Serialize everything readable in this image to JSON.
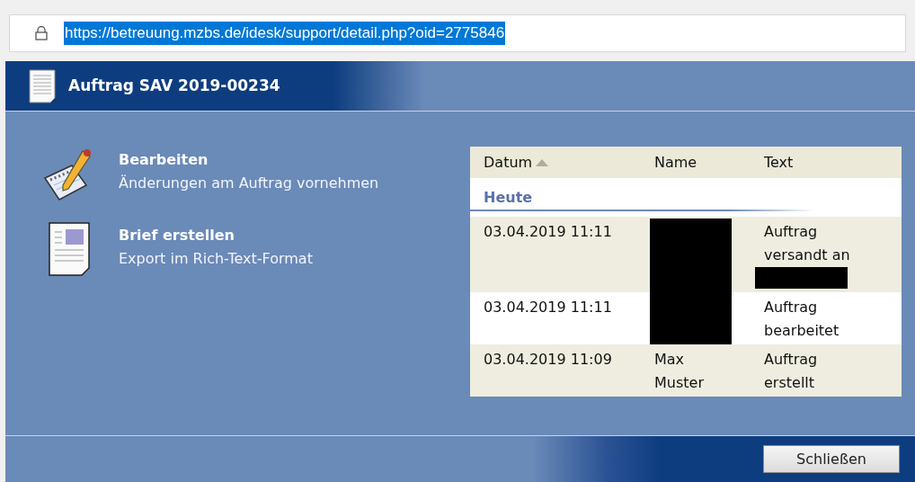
{
  "address_bar": {
    "url": "https://betreuung.mzbs.de/idesk/support/detail.php?oid=2775846",
    "url_selected": true
  },
  "header": {
    "title": "Auftrag SAV 2019-00234"
  },
  "actions": [
    {
      "kind": "edit",
      "title": "Bearbeiten",
      "description": "Änderungen am Auftrag vornehmen"
    },
    {
      "kind": "letter",
      "title": "Brief erstellen",
      "description": "Export im Rich-Text-Format"
    }
  ],
  "table": {
    "columns": [
      {
        "label": "Datum",
        "sorted": true
      },
      {
        "label": "Name",
        "sorted": false
      },
      {
        "label": "Text",
        "sorted": false
      }
    ],
    "group": "Heute",
    "rows": [
      {
        "date": "03.04.2019 11:11",
        "name_redacted": true,
        "text": "Auftrag versandt an",
        "text_redaction": true
      },
      {
        "date": "03.04.2019 11:11",
        "name_redacted": true,
        "text": "Auftrag bearbeitet",
        "text_redaction": false
      },
      {
        "date": "03.04.2019 11:09",
        "name": "Max Muster",
        "name_redacted": false,
        "text": "Auftrag erstellt",
        "text_redaction": false
      }
    ]
  },
  "buttons": [
    {
      "label": "Schließen"
    }
  ]
}
